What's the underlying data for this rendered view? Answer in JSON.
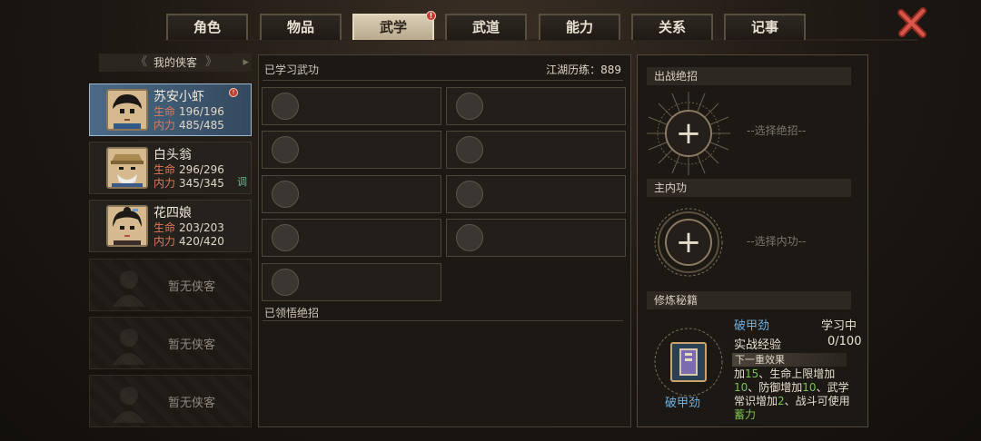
{
  "tabs": [
    {
      "label": "角色",
      "active": false
    },
    {
      "label": "物品",
      "active": false
    },
    {
      "label": "武学",
      "active": true,
      "badge": "!"
    },
    {
      "label": "武道",
      "active": false
    },
    {
      "label": "能力",
      "active": false
    },
    {
      "label": "关系",
      "active": false
    },
    {
      "label": "记事",
      "active": false
    }
  ],
  "roster": {
    "header": "我的侠客",
    "characters": [
      {
        "name": "苏安小虾",
        "hp_label": "生命",
        "hp": "196/196",
        "mp_label": "内力",
        "mp": "485/485",
        "badge": "!",
        "tag": "",
        "selected": true
      },
      {
        "name": "白头翁",
        "hp_label": "生命",
        "hp": "296/296",
        "mp_label": "内力",
        "mp": "345/345",
        "badge": "",
        "tag": "调",
        "selected": false
      },
      {
        "name": "花四娘",
        "hp_label": "生命",
        "hp": "203/203",
        "mp_label": "内力",
        "mp": "420/420",
        "badge": "",
        "tag": "",
        "selected": false
      }
    ],
    "empty_slots": [
      "暂无侠客",
      "暂无侠客",
      "暂无侠客"
    ]
  },
  "martial": {
    "learned_title": "已学习武功",
    "experience_label": "江湖历练：889",
    "insight_title": "已领悟绝招",
    "slot_count": 9
  },
  "right": {
    "battle_skill_title": "出战绝招",
    "battle_skill_placeholder": "--选择绝招--",
    "inner_title": "主内功",
    "inner_placeholder": "--选择内功--",
    "manual_title": "修炼秘籍",
    "manual": {
      "book_name": "破甲劲",
      "skill_name": "破甲劲",
      "status": "学习中",
      "exp_label": "实战经验",
      "exp_value": "0/100",
      "next_effect_label": "下一重效果",
      "effect_parts": {
        "p1": "加",
        "n1": "15",
        "p2": "、生命上限增加",
        "n2": "10",
        "p3": "、防御增加",
        "n3": "10",
        "p4": "、武学常识增加",
        "n4": "2",
        "p5": "、战斗可使用",
        "n5": "蓄力"
      }
    }
  },
  "colors": {
    "accent_blue": "#6fb0e0",
    "stat_red": "#e07856",
    "effect_green": "#7bc24a",
    "active_tab": "#d9cdb4"
  }
}
